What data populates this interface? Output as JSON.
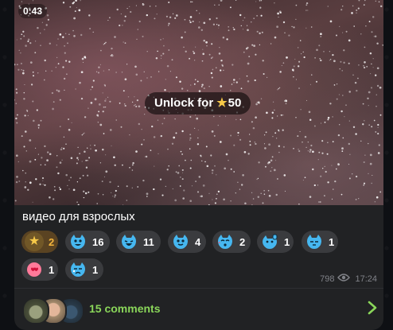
{
  "media": {
    "duration": "0:43",
    "unlock_prefix": "Unlock for",
    "unlock_star_icon": "star-icon",
    "unlock_price": "50"
  },
  "caption": "видео для взрослых",
  "reactions": [
    {
      "icon": "star-icon",
      "count": "2"
    },
    {
      "icon": "blue-cat-grin-icon",
      "count": "16"
    },
    {
      "icon": "blue-cat-laugh-icon",
      "count": "11"
    },
    {
      "icon": "blue-cat-smile-icon",
      "count": "4"
    },
    {
      "icon": "blue-cat-kiss-icon",
      "count": "2"
    },
    {
      "icon": "blue-cat-thumbs-icon",
      "count": "1"
    },
    {
      "icon": "blue-cat-sleepy-icon",
      "count": "1"
    },
    {
      "icon": "heart-face-icon",
      "count": "1"
    },
    {
      "icon": "blue-cat-cry-icon",
      "count": "1"
    }
  ],
  "meta": {
    "views": "798",
    "time": "17:24"
  },
  "comments": {
    "label": "15 comments"
  },
  "colors": {
    "accent_green": "#8ad65a",
    "star_gold": "#f7c948",
    "bubble": "#212224"
  }
}
